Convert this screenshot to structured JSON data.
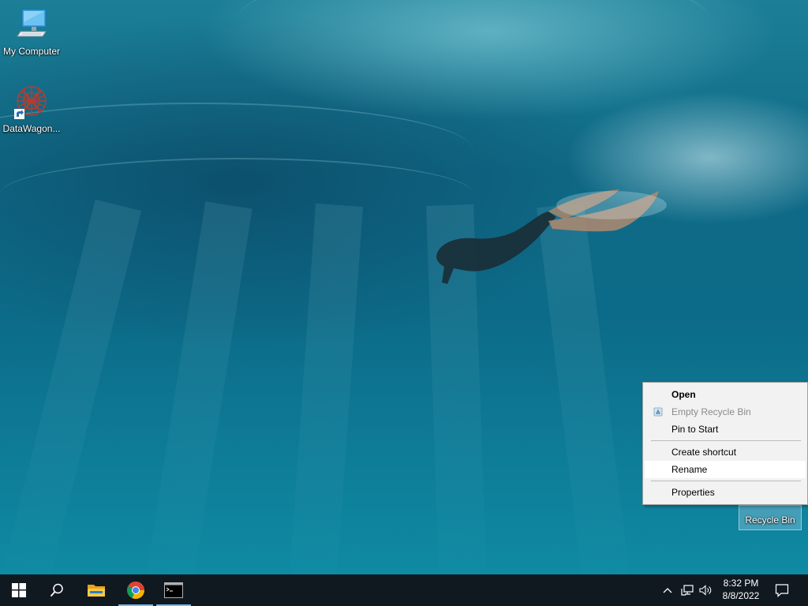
{
  "desktop": {
    "icons": [
      {
        "label": "My Computer",
        "icon": "computer-monitor-icon"
      },
      {
        "label": "DataWagon...",
        "icon": "datawagon-app-icon"
      },
      {
        "label": "Recycle Bin",
        "icon": "recycle-bin-icon"
      }
    ]
  },
  "context_menu": {
    "items": [
      {
        "label": "Open",
        "style": "bold"
      },
      {
        "label": "Empty Recycle Bin",
        "style": "disabled",
        "icon": "recycle-icon"
      },
      {
        "label": "Pin to Start"
      },
      {
        "label": "Create shortcut"
      },
      {
        "label": "Rename",
        "state": "hovered"
      },
      {
        "label": "Properties"
      }
    ]
  },
  "taskbar": {
    "buttons": [
      {
        "icon": "windows-start-icon"
      },
      {
        "icon": "search-icon"
      },
      {
        "icon": "file-explorer-icon"
      },
      {
        "icon": "chrome-icon",
        "active": true
      },
      {
        "icon": "command-prompt-icon",
        "active": true
      }
    ],
    "tray": {
      "icons": [
        "chevron-up-icon",
        "network-icon",
        "volume-icon",
        "action-center-icon"
      ],
      "time": "8:32 PM",
      "date": "8/8/2022"
    }
  },
  "colors": {
    "taskbar_bg": "#101820",
    "active_indicator": "#76b9ed",
    "menu_bg": "#f2f2f2",
    "menu_hover": "#ffffff",
    "disabled_text": "#8a8a8a"
  }
}
